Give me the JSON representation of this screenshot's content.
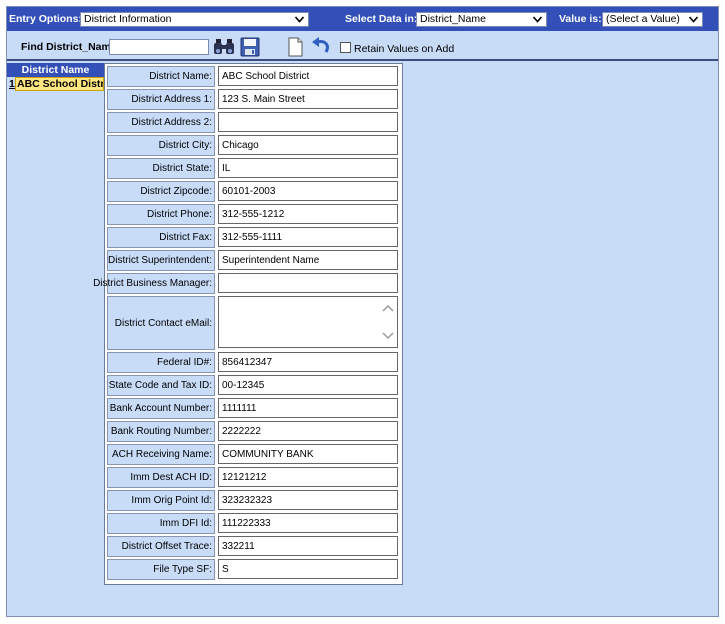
{
  "topbar": {
    "entry_options_label": "Entry Options:",
    "entry_options_value": "District Information",
    "select_data_label": "Select Data in:",
    "select_data_value": "District_Name",
    "value_is_label": "Value is:",
    "value_is_value": "(Select a Value)"
  },
  "findbar": {
    "find_label": "Find District_Name",
    "find_value": "",
    "retain_label": "Retain Values on Add",
    "retain_checked": false
  },
  "list": {
    "header": "District Name",
    "items": [
      {
        "num": "1",
        "name": "ABC School District"
      }
    ]
  },
  "form": {
    "fields": [
      {
        "label": "District Name:",
        "value": "ABC School District"
      },
      {
        "label": "District Address 1:",
        "value": "123 S. Main Street"
      },
      {
        "label": "District Address 2:",
        "value": ""
      },
      {
        "label": "District City:",
        "value": "Chicago"
      },
      {
        "label": "District State:",
        "value": "IL"
      },
      {
        "label": "District Zipcode:",
        "value": "60101-2003"
      },
      {
        "label": "District Phone:",
        "value": "312-555-1212"
      },
      {
        "label": "District Fax:",
        "value": "312-555-1111"
      },
      {
        "label": "District Superintendent:",
        "value": "Superintendent Name"
      },
      {
        "label": "District Business Manager:",
        "value": ""
      },
      {
        "label": "District Contact eMail:",
        "value": ""
      },
      {
        "label": "Federal ID#:",
        "value": "856412347"
      },
      {
        "label": "State Code and Tax ID:",
        "value": "00-12345"
      },
      {
        "label": "Bank Account Number:",
        "value": "1111111"
      },
      {
        "label": "Bank Routing Number:",
        "value": "2222222"
      },
      {
        "label": "ACH Receiving Name:",
        "value": "COMMUNITY BANK"
      },
      {
        "label": "Imm Dest ACH ID:",
        "value": "12121212"
      },
      {
        "label": "Imm Orig Point Id:",
        "value": "323232323"
      },
      {
        "label": "Imm DFI Id:",
        "value": "111222333"
      },
      {
        "label": "District Offset Trace:",
        "value": "332211"
      },
      {
        "label": "File Type SF:",
        "value": "S"
      }
    ]
  },
  "colors": {
    "header_blue": "#3350b8",
    "panel_blue": "#c8dcf8",
    "highlight": "#ffe680"
  },
  "icons": [
    "binoculars-icon",
    "save-disk-icon",
    "new-document-icon",
    "undo-arrow-icon",
    "chevron-down-icon"
  ]
}
